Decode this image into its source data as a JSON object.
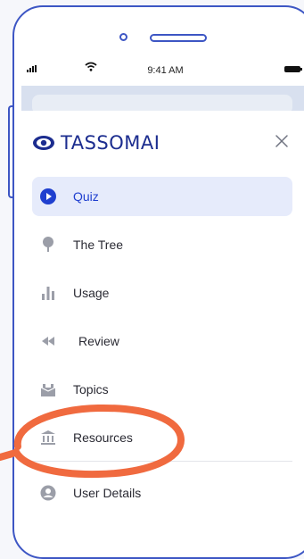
{
  "status_bar": {
    "time": "9:41 AM"
  },
  "brand": {
    "name": "TASSOMAI",
    "color": "#1c2d8f"
  },
  "menu": {
    "items": [
      {
        "label": "Quiz",
        "icon": "play-circle-icon",
        "active": true
      },
      {
        "label": "The Tree",
        "icon": "tree-icon"
      },
      {
        "label": "Usage",
        "icon": "bar-chart-icon"
      },
      {
        "label": "Review",
        "icon": "rewind-icon"
      },
      {
        "label": "Topics",
        "icon": "books-icon"
      },
      {
        "label": "Resources",
        "icon": "bank-icon"
      },
      {
        "label": "User Details",
        "icon": "user-circle-icon"
      }
    ]
  },
  "colors": {
    "accent": "#1f3fcf",
    "active_bg": "#e6ebfb",
    "frame": "#3d56c4",
    "annotation": "#f06a3f"
  }
}
